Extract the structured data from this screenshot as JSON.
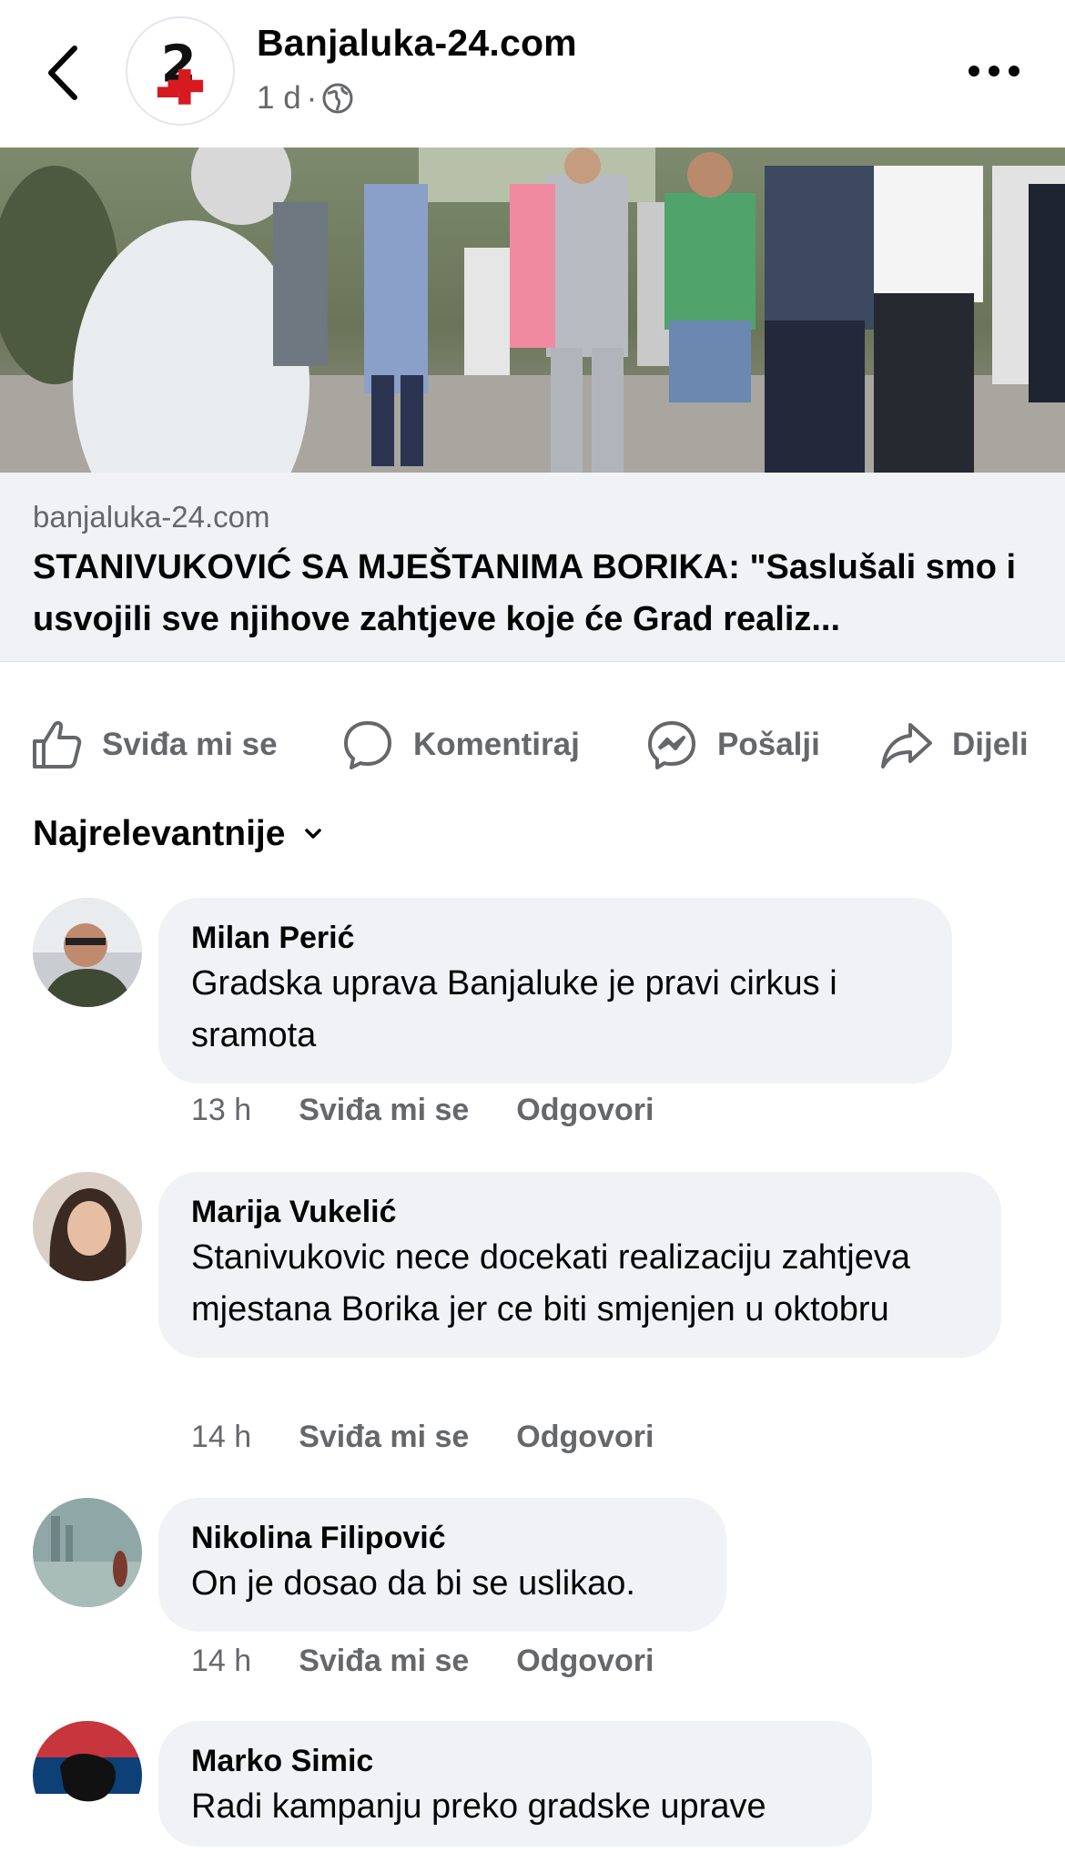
{
  "header": {
    "page_name": "Banjaluka-24.com",
    "time": "1 d",
    "separator": "·",
    "brand_color": "#d71a20"
  },
  "link_preview": {
    "domain": "banjaluka-24.com",
    "title": "STANIVUKOVIĆ SA MJEŠTANIMA BORIKA: \"Saslušali smo i usvojili sve njihove zahtjeve koje će Grad realiz..."
  },
  "actions": {
    "like": "Sviđa mi se",
    "comment": "Komentiraj",
    "send": "Pošalji",
    "share": "Dijeli"
  },
  "sort": {
    "label": "Najrelevantnije"
  },
  "comments": [
    {
      "name": "Milan Perić",
      "text": "Gradska uprava Banjaluke je pravi cirkus i sramota",
      "time": "13 h",
      "like": "Sviđa mi se",
      "reply": "Odgovori"
    },
    {
      "name": "Marija Vukelić",
      "text": "Stanivukovic nece docekati realizaciju zahtjeva mjestana Borika jer ce biti smjenjen u oktobru",
      "time": "14 h",
      "like": "Sviđa mi se",
      "reply": "Odgovori"
    },
    {
      "name": "Nikolina Filipović",
      "text": "On je dosao da bi se uslikao.",
      "time": "14 h",
      "like": "Sviđa mi se",
      "reply": "Odgovori"
    },
    {
      "name": "Marko Simic",
      "text": "Radi kampanju preko gradske uprave"
    }
  ]
}
